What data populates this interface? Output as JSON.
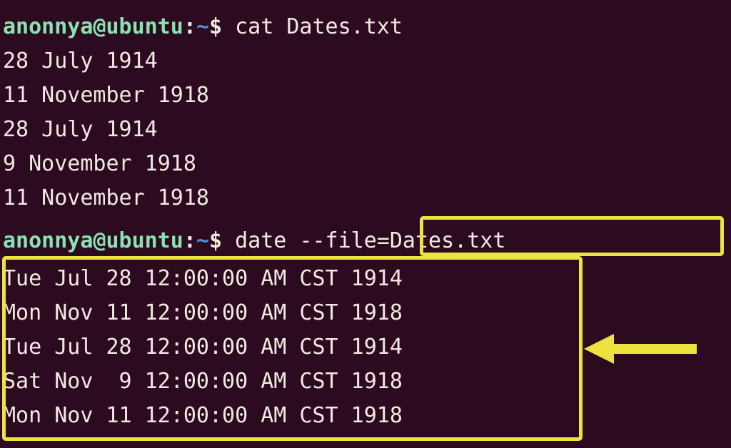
{
  "terminal": {
    "background_color": "#2c0a20",
    "foreground_color": "#f2e9e1",
    "prompt_color": "#8ae2b0",
    "highlight_color": "#ece33c",
    "tilde_color": "#4f8fd6"
  },
  "prompt": {
    "user_host": "anonnya@ubuntu",
    "colon": ":",
    "tilde": "~",
    "dollar": "$"
  },
  "commands": {
    "first": "cat Dates.txt",
    "second_name": "date",
    "second_arg": "--file=Dates.txt"
  },
  "file_contents": [
    "28 July 1914",
    "11 November 1918",
    "28 July 1914",
    "9 November 1918",
    "11 November 1918"
  ],
  "command_output": [
    "Tue Jul 28 12:00:00 AM CST 1914",
    "Mon Nov 11 12:00:00 AM CST 1918",
    "Tue Jul 28 12:00:00 AM CST 1914",
    "Sat Nov  9 12:00:00 AM CST 1918",
    "Mon Nov 11 12:00:00 AM CST 1918"
  ],
  "annotations": {
    "arrow_direction": "left",
    "arrow_color": "#ece33c"
  }
}
